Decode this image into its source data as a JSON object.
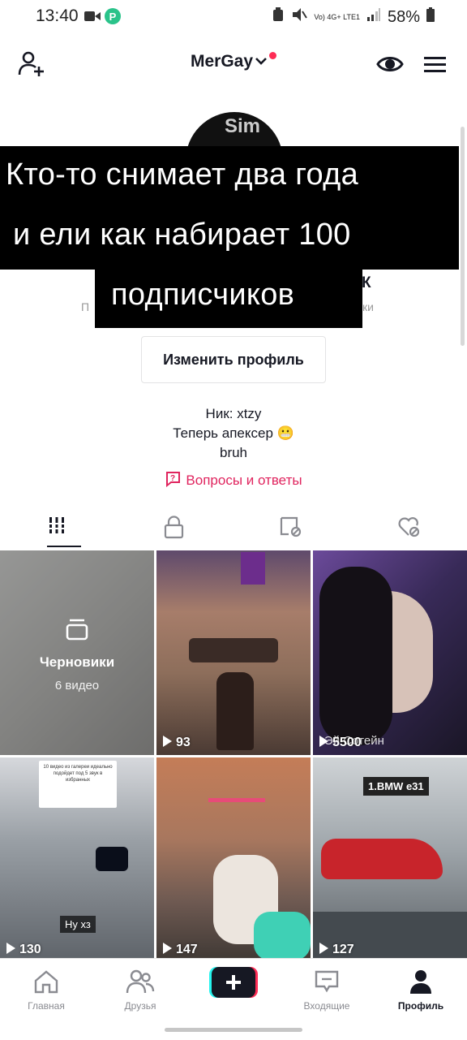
{
  "status_bar": {
    "time": "13:40",
    "network": "Vo) 4G+ LTE1",
    "battery": "58%"
  },
  "header": {
    "username": "MerGay"
  },
  "avatar": {
    "text": "Sim"
  },
  "caption": {
    "line1": "Кто-то снимает два года",
    "line2": "и ели как набирает 100",
    "line3": "подписчиков"
  },
  "partial": {
    "left": "П",
    "right": "ки",
    "k": "К"
  },
  "profile": {
    "edit_button": "Изменить профиль",
    "bio_line1": "Ник: xtzy",
    "bio_line2": "Теперь апексер 😬",
    "bio_line3": "bruh",
    "qa_link": "Вопросы и ответы"
  },
  "grid": {
    "drafts_label": "Черновики",
    "drafts_count": "6 видео",
    "items": [
      {
        "views": "93"
      },
      {
        "views": "5500",
        "overlay_text": "Эй Сотейн"
      },
      {
        "views": "130",
        "overlay_text": "Ну хз",
        "note": "10 видео из галереи идеально подойдет под 5 звук в избранных"
      },
      {
        "views": "147"
      },
      {
        "views": "127",
        "overlay_text": "1.BMW e31"
      }
    ]
  },
  "nav": {
    "home": "Главная",
    "friends": "Друзья",
    "inbox": "Входящие",
    "profile": "Профиль"
  },
  "colors": {
    "accent": "#fe2c55",
    "link": "#e0245e",
    "text": "#161823",
    "muted": "#8a8b91"
  }
}
